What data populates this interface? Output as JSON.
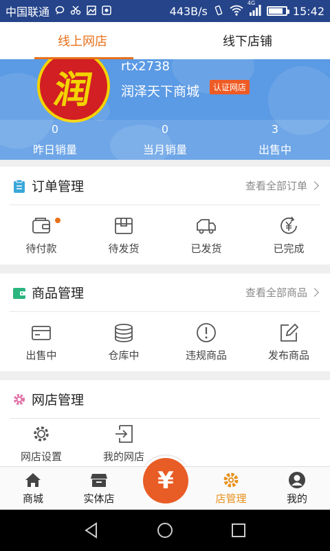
{
  "statusbar": {
    "carrier": "中国联通",
    "speed": "443B/s",
    "network": "4G",
    "time": "15:42",
    "battery_level": 0.85
  },
  "tabs": [
    {
      "label": "线上网店",
      "active": true
    },
    {
      "label": "线下店铺",
      "active": false
    }
  ],
  "shop": {
    "logo_char": "润",
    "id": "rtx2738",
    "name": "润泽天下商城",
    "cert_badge": "认证网店"
  },
  "stats": [
    {
      "value": "0",
      "label": "昨日销量"
    },
    {
      "value": "0",
      "label": "当月销量"
    },
    {
      "value": "3",
      "label": "出售中"
    }
  ],
  "orders": {
    "title": "订单管理",
    "link": "查看全部订单",
    "icon": "clipboard-icon",
    "items": [
      {
        "label": "待付款",
        "icon": "wallet-icon",
        "has_dot": true
      },
      {
        "label": "待发货",
        "icon": "package-icon",
        "has_dot": false
      },
      {
        "label": "已发货",
        "icon": "truck-icon",
        "has_dot": false
      },
      {
        "label": "已完成",
        "icon": "yen-refresh-icon",
        "has_dot": false
      }
    ]
  },
  "goods": {
    "title": "商品管理",
    "link": "查看全部商品",
    "icon": "wallet-green-icon",
    "items": [
      {
        "label": "出售中",
        "icon": "card-icon"
      },
      {
        "label": "仓库中",
        "icon": "stack-icon"
      },
      {
        "label": "违规商品",
        "icon": "warning-icon"
      },
      {
        "label": "发布商品",
        "icon": "edit-icon"
      }
    ]
  },
  "store": {
    "title": "网店管理",
    "icon": "gear-pink-icon",
    "items": [
      {
        "label": "网店设置",
        "icon": "gear-icon"
      },
      {
        "label": "我的网店",
        "icon": "enter-icon"
      }
    ]
  },
  "bottomnav": [
    {
      "label": "商城",
      "icon": "home-icon",
      "active": false
    },
    {
      "label": "实体店",
      "icon": "store-icon",
      "active": false
    },
    {
      "label": "¥",
      "icon": "yen-icon",
      "active": false
    },
    {
      "label": "店管理",
      "icon": "gear-icon",
      "active": true
    },
    {
      "label": "我的",
      "icon": "person-icon",
      "active": false
    }
  ],
  "colors": {
    "accent": "#e8701a",
    "banner": "#5b9ae4",
    "statusbar": "#25448a",
    "yen_button": "#e85c25"
  }
}
